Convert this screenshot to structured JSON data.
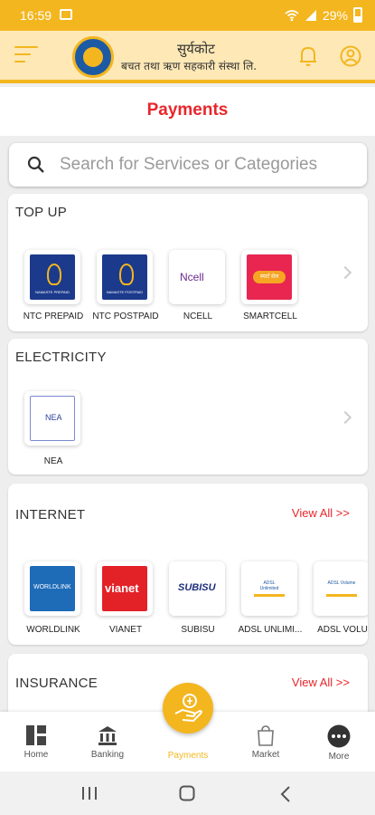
{
  "status_bar": {
    "time": "16:59",
    "battery": "29%"
  },
  "header": {
    "title": "सुर्यकोट",
    "subtitle": "बचत तथा ऋण सहकारी संस्था लि."
  },
  "page": {
    "title": "Payments"
  },
  "search": {
    "placeholder": "Search for Services or Categories"
  },
  "sections": {
    "topup": {
      "title": "TOP UP",
      "items": [
        {
          "label": "NTC PREPAID",
          "logo_text": "NAMASTE PREPAID"
        },
        {
          "label": "NTC POSTPAID",
          "logo_text": "NAMASTE POSTPAID"
        },
        {
          "label": "NCELL",
          "logo_text": "Ncell"
        },
        {
          "label": "SMARTCELL",
          "logo_text": "स्मार्ट सेल"
        }
      ]
    },
    "electricity": {
      "title": "ELECTRICITY",
      "items": [
        {
          "label": "NEA",
          "logo_text": "NEA"
        }
      ]
    },
    "internet": {
      "title": "INTERNET",
      "view_all": "View All >>",
      "items": [
        {
          "label": "WORLDLINK",
          "logo_text": "WORLDLINK"
        },
        {
          "label": "VIANET",
          "logo_text": "vianet"
        },
        {
          "label": "SUBISU",
          "logo_text": "SUBISU"
        },
        {
          "label": "ADSL UNLIMI...",
          "logo_text": "ADSL Unlimited"
        },
        {
          "label": "ADSL VOLU",
          "logo_text": "ADSL Volume"
        }
      ]
    },
    "insurance": {
      "title": "INSURANCE",
      "view_all": "View All >>"
    }
  },
  "bottom_nav": {
    "home": "Home",
    "banking": "Banking",
    "payments": "Payments",
    "market": "Market",
    "more": "More"
  },
  "colors": {
    "brand": "#f3b61f",
    "accent_red": "#e8262b",
    "header_bg": "#fde8b6"
  }
}
